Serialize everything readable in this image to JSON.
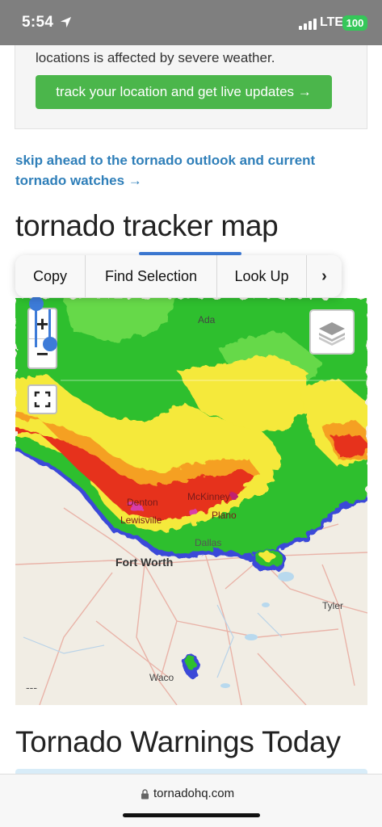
{
  "status_bar": {
    "time": "5:54",
    "network": "LTE",
    "battery": "100",
    "location_icon": "location-arrow-icon",
    "signal_icon": "cellular-signal-icon"
  },
  "alert_card": {
    "text": "locations is affected by severe weather.",
    "button_label": "track your location and get live updates →",
    "button_color": "#4bb64b"
  },
  "skip_link": {
    "line1": "skip ahead to the tornado outlook and current",
    "line2": "tornado watches →",
    "color": "#2f7fb9"
  },
  "map_section": {
    "title": "tornado tracker map",
    "zoom_in_label": "+",
    "zoom_out_label": "−",
    "fullscreen_icon": "fullscreen-icon",
    "layers_icon": "layers-icon",
    "scale_text": "---",
    "labels": {
      "ada": "Ada",
      "mckinney": "McKinney",
      "denton": "Denton",
      "lewisville": "Lewisville",
      "plano": "Plano",
      "dallas": "Dallas",
      "fort_worth": "Fort Worth",
      "tyler": "Tyler",
      "waco": "Waco"
    }
  },
  "context_menu": {
    "copy": "Copy",
    "find_selection": "Find Selection",
    "look_up": "Look Up",
    "more": "›"
  },
  "warnings": {
    "title": "Tornado Warnings Today"
  },
  "browser": {
    "url": "tornadohq.com",
    "lock_icon": "lock-icon"
  }
}
